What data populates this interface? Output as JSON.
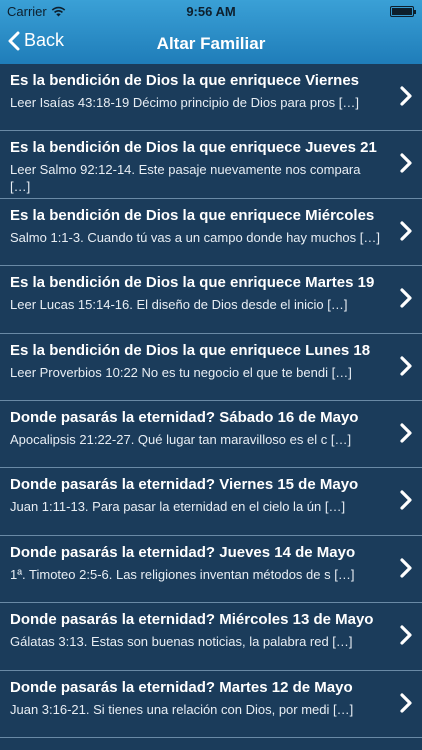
{
  "status_bar": {
    "carrier": "Carrier",
    "time": "9:56 AM",
    "icons": [
      "wifi-icon",
      "battery-icon"
    ]
  },
  "nav": {
    "back_label": "Back",
    "title": "Altar Familiar"
  },
  "items": [
    {
      "title": "Es la bendición de Dios la que enriquece Viernes",
      "excerpt": "Leer Isaías 43:18-19 Décimo principio de Dios para pros […]"
    },
    {
      "title": "Es la bendición de Dios la que enriquece Jueves 21",
      "excerpt": "Leer Salmo 92:12-14. Este pasaje nuevamente nos compara […]"
    },
    {
      "title": "Es la bendición de Dios la que enriquece Miércoles",
      "excerpt": "Salmo 1:1-3. Cuando tú vas a un campo donde hay muchos […]"
    },
    {
      "title": "Es la bendición de Dios la que enriquece Martes 19",
      "excerpt": "Leer Lucas 15:14-16. El diseño de Dios desde el inicio […]"
    },
    {
      "title": "Es la bendición de Dios la que enriquece Lunes 18",
      "excerpt": "Leer  Proverbios 10:22 No es tu negocio el que te bendi […]"
    },
    {
      "title": "Donde pasarás la eternidad? Sábado 16 de Mayo",
      "excerpt": "Apocalipsis 21:22-27. Qué lugar tan maravilloso es el c […]"
    },
    {
      "title": "Donde pasarás la eternidad? Viernes 15 de Mayo",
      "excerpt": "Juan 1:11-13. Para pasar la eternidad en el cielo la ún […]"
    },
    {
      "title": "Donde pasarás la eternidad? Jueves 14 de Mayo",
      "excerpt": "1ª. Timoteo 2:5-6. Las religiones inventan métodos de s […]"
    },
    {
      "title": "Donde pasarás la eternidad? Miércoles 13 de Mayo",
      "excerpt": "Gálatas 3:13. Estas son buenas noticias, la palabra red […]"
    },
    {
      "title": "Donde pasarás la eternidad? Martes 12 de Mayo",
      "excerpt": "Juan 3:16-21. Si tienes una relación con Dios, por medi […]"
    }
  ],
  "colors": {
    "nav_gradient_top": "#3aa0d6",
    "nav_gradient_bottom": "#1f7db9",
    "list_background": "#1b3c5b",
    "separator": "#6a8aa6",
    "text": "#ffffff"
  }
}
